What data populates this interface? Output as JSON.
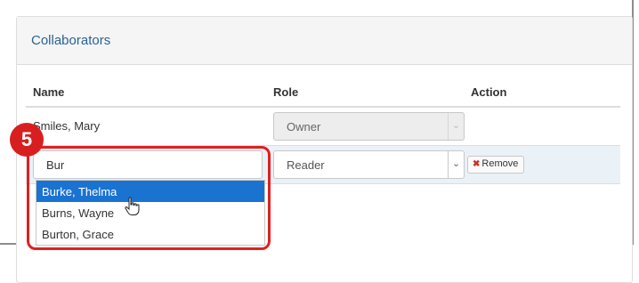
{
  "panel": {
    "title": "Collaborators"
  },
  "table": {
    "headers": {
      "name": "Name",
      "role": "Role",
      "action": "Action"
    },
    "rows": [
      {
        "name": "Smiles, Mary",
        "role": "Owner"
      },
      {
        "search_value": "Bur",
        "role": "Reader",
        "action_label": "Remove"
      }
    ]
  },
  "autocomplete": {
    "options": [
      "Burke, Thelma",
      "Burns, Wayne",
      "Burton, Grace"
    ],
    "highlighted_index": 0
  },
  "annotation": {
    "step_number": "5",
    "color": "#d81f1f"
  },
  "icons": {
    "dropdown_arrow": "chevron-down-icon",
    "remove": "x-icon",
    "cursor": "hand-pointer-icon"
  }
}
